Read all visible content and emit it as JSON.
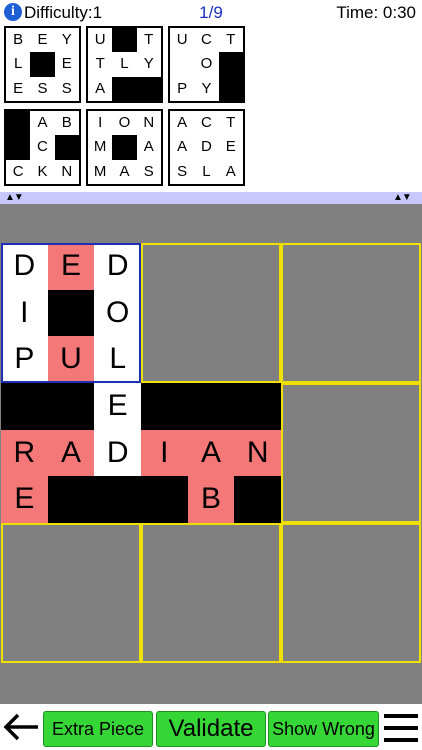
{
  "header": {
    "info_icon": "i",
    "difficulty": "Difficulty:1",
    "counter": "1/9",
    "timer": "Time: 0:30"
  },
  "tray": [
    {
      "cells": [
        [
          "B",
          "E",
          "Y"
        ],
        [
          "L",
          "#",
          "E"
        ],
        [
          "E",
          "S",
          "S"
        ]
      ]
    },
    {
      "cells": [
        [
          "U",
          "#",
          "T"
        ],
        [
          "T",
          "L",
          "Y"
        ],
        [
          "A",
          "#",
          "#"
        ]
      ]
    },
    {
      "cells": [
        [
          "U",
          "C",
          "T"
        ],
        [
          "",
          "O",
          "#"
        ],
        [
          "P",
          "Y",
          "#"
        ]
      ]
    },
    {
      "cells": [
        [
          "#",
          "A",
          "B"
        ],
        [
          "#",
          "C",
          "#"
        ],
        [
          "C",
          "K",
          "N"
        ]
      ]
    },
    {
      "cells": [
        [
          "I",
          "O",
          "N"
        ],
        [
          "M",
          "#",
          "A"
        ],
        [
          "M",
          "A",
          "S"
        ]
      ]
    },
    {
      "cells": [
        [
          "A",
          "C",
          "T"
        ],
        [
          "A",
          "D",
          "E"
        ],
        [
          "S",
          "L",
          "A"
        ]
      ]
    }
  ],
  "strip": {
    "left_arrows": "▲▼",
    "right_arrows": "▲▼"
  },
  "board": {
    "placed": [
      {
        "slot": 0,
        "selected": true,
        "cells": [
          [
            {
              "t": "D",
              "c": "white"
            },
            {
              "t": "E",
              "c": "red"
            },
            {
              "t": "D",
              "c": "white"
            }
          ],
          [
            {
              "t": "I",
              "c": "white"
            },
            {
              "t": "",
              "c": "black"
            },
            {
              "t": "O",
              "c": "white"
            }
          ],
          [
            {
              "t": "P",
              "c": "white"
            },
            {
              "t": "U",
              "c": "red"
            },
            {
              "t": "L",
              "c": "white"
            }
          ]
        ]
      },
      {
        "slot": 3,
        "selected": false,
        "cells": [
          [
            {
              "t": "",
              "c": "black"
            },
            {
              "t": "",
              "c": "black"
            },
            {
              "t": "E",
              "c": "white"
            }
          ],
          [
            {
              "t": "R",
              "c": "red"
            },
            {
              "t": "A",
              "c": "red"
            },
            {
              "t": "D",
              "c": "white"
            }
          ],
          [
            {
              "t": "E",
              "c": "red"
            },
            {
              "t": "",
              "c": "black"
            },
            {
              "t": "",
              "c": "black"
            }
          ]
        ]
      },
      {
        "slot": 4,
        "selected": false,
        "cells": [
          [
            {
              "t": "",
              "c": "black"
            },
            {
              "t": "",
              "c": "black"
            },
            {
              "t": "",
              "c": "black"
            }
          ],
          [
            {
              "t": "I",
              "c": "red"
            },
            {
              "t": "A",
              "c": "red"
            },
            {
              "t": "N",
              "c": "red"
            }
          ],
          [
            {
              "t": "",
              "c": "black"
            },
            {
              "t": "B",
              "c": "red"
            },
            {
              "t": "",
              "c": "black"
            }
          ]
        ]
      }
    ]
  },
  "footer": {
    "back_icon": "arrow-left-icon",
    "extra_piece": "Extra Piece",
    "validate": "Validate",
    "show_wrong": "Show Wrong",
    "menu_icon": "hamburger-menu-icon"
  },
  "colors": {
    "red": "#f47878",
    "green": "#35d635",
    "slot_border": "#f0e000",
    "board_bg": "#808080",
    "strip": "#c8c8ff",
    "selected_border": "#1d2fb5"
  }
}
